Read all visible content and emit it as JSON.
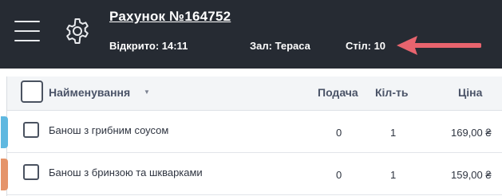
{
  "header": {
    "title": "Рахунок №164752",
    "opened": "Відкрито: 14:11",
    "hall": "Зал: Тераса",
    "table": "Стіл: 10",
    "menu_icon": "hamburger-menu-icon",
    "settings_icon": "gear-icon",
    "arrow_color": "#e8646e",
    "background": "#262b33"
  },
  "table": {
    "headers": {
      "name": "Найменування",
      "sort_indicator": "▼",
      "serve": "Подача",
      "qty": "Кіл-ть",
      "price": "Ціна"
    },
    "rows": [
      {
        "name": "Банош з грибним соусом",
        "serve": "0",
        "qty": "1",
        "price": "169,00 ₴",
        "marker_color": "#5fb8e0"
      },
      {
        "name": "Банош з бринзою та шкварками",
        "serve": "0",
        "qty": "1",
        "price": "159,00 ₴",
        "marker_color": "#e5946a"
      }
    ]
  }
}
